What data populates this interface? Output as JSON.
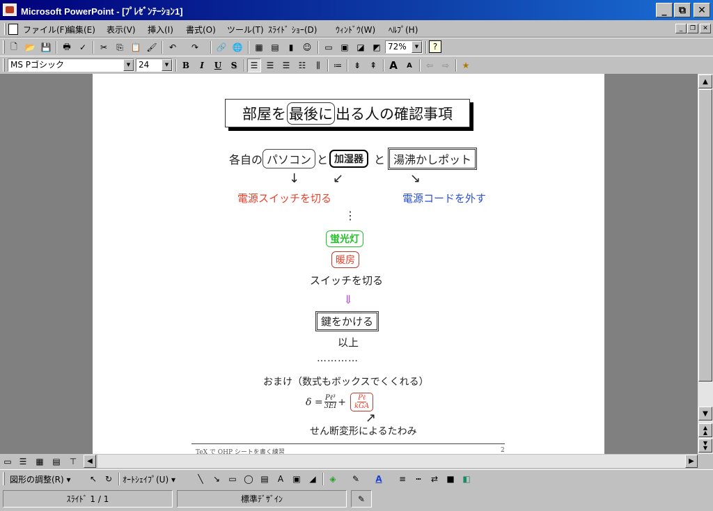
{
  "window": {
    "title": "Microsoft PowerPoint - [ﾌﾟﾚｾﾞﾝﾃｰｼｮﾝ1]",
    "minimize": "_",
    "restore": "⧉",
    "close": "✕"
  },
  "menubar": {
    "items": [
      "ファイル(F)",
      "編集(E)",
      "表示(V)",
      "挿入(I)",
      "書式(O)",
      "ツール(T)",
      "ｽﾗｲﾄﾞ ｼｮｰ(D)",
      "ｳｨﾝﾄﾞｳ(W)",
      "ﾍﾙﾌﾟ(H)"
    ]
  },
  "standard_toolbar": {
    "zoom": "72%",
    "help": "?"
  },
  "format_toolbar": {
    "font": "MS Pゴシック",
    "size": "24",
    "bold": "B",
    "italic": "I",
    "underline": "U",
    "shadow": "S"
  },
  "slide": {
    "title_pre": "部屋を",
    "title_boxed": "最後に",
    "title_post": "出る人の確認事項",
    "line1_pre": "各自の",
    "pc": "パソコン",
    "and1": "と",
    "humidifier": "加湿器",
    "and2": "と",
    "kettle": "湯沸かしポット",
    "arrow_down": "↓",
    "arrow_sw": "↙",
    "arrow_se": "↘",
    "switch_off": "電源スイッチを切る",
    "unplug": "電源コードを外す",
    "vdots": "⋮",
    "fluorescent": "蛍光灯",
    "heater": "暖房",
    "switch_off2": "スイッチを切る",
    "dbl_arrow": "⇓",
    "lock": "鍵をかける",
    "end": "以上",
    "dots": "…………",
    "bonus": "おまけ（数式もボックスでくくれる）",
    "formula_delta": "δ =",
    "frac1_num": "Pℓ³",
    "frac1_den": "3EI",
    "plus": "+",
    "frac2_num": "Pℓ",
    "frac2_den": "kGA",
    "arrow_ne": "↗",
    "shear": "せん断変形によるたわみ",
    "footer_left": "TeX で OHP シートを書く練習",
    "footer_right": "2"
  },
  "colors": {
    "red": "#e8412c",
    "blue": "#2a4fd8",
    "green": "#22c22a",
    "magenta": "#c050e0"
  },
  "drawing_toolbar": {
    "draw": "図形の調整(R)",
    "autoshape": "ｵｰﾄｼｪｲﾌﾟ(U)"
  },
  "status": {
    "slide": "ｽﾗｲﾄﾞ 1 / 1",
    "design": "標準ﾃﾞｻﾞｲﾝ"
  }
}
